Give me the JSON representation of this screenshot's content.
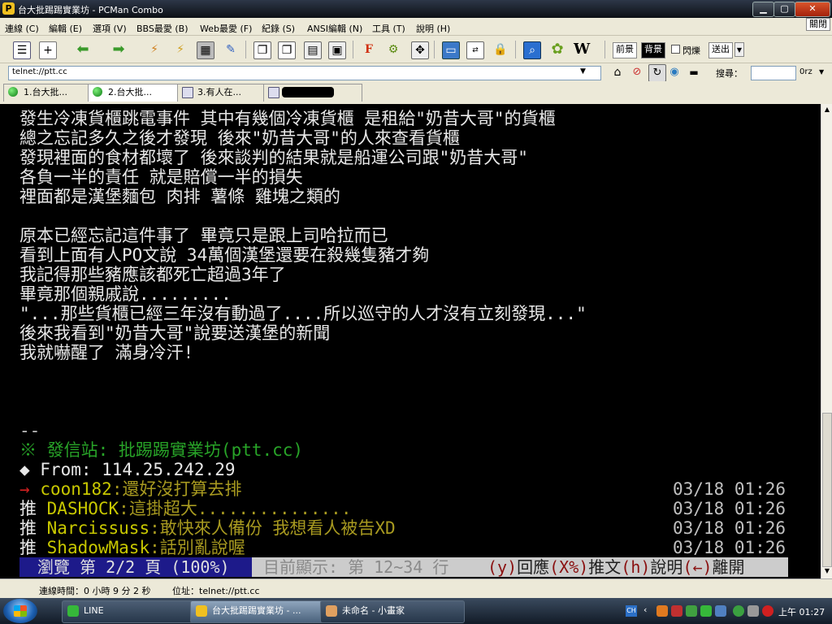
{
  "window": {
    "title": "台大批踢踢實業坊 - PCMan Combo",
    "app_icon": "PCMan",
    "controls": {
      "minimize": "▁",
      "maximize": "▢",
      "close": "✕"
    }
  },
  "menubar": {
    "items": [
      "連線 (C)",
      "編輯 (E)",
      "選項 (V)",
      "BBS最愛 (B)",
      "Web最愛 (F)",
      "紀錄 (S)",
      "ANSI編輯 (N)",
      "工具 (T)",
      "說明 (H)"
    ],
    "close_label": "關閉"
  },
  "toolbar": {
    "icons": [
      "connect-icon",
      "new-tab-icon",
      "back-icon",
      "forward-icon",
      "disconnect-icon",
      "reconnect-icon",
      "save-icon",
      "add-favorite-icon",
      "copy-icon",
      "paste-icon",
      "copy-ansi-icon",
      "screenshot-icon",
      "font-icon",
      "settings-icon",
      "fullscreen-icon",
      "monitor-icon",
      "auto-reply-icon",
      "lock-icon",
      "search-icon",
      "flower-icon",
      "wiki-icon"
    ],
    "foreground_label": "前景",
    "background_label": "背景",
    "blink_label": "閃爍",
    "send_label": "送出",
    "wiki_glyph": "W",
    "font_glyph": "F"
  },
  "addressbar": {
    "value": "telnet://ptt.cc",
    "search_label": "搜尋：",
    "search_value": "",
    "search_engine": "0rz"
  },
  "tabs": [
    {
      "label": "1.台大批..."
    },
    {
      "label": "2.台大批..."
    },
    {
      "label": "3.有人在..."
    },
    {
      "label": ""
    }
  ],
  "terminal": {
    "body_lines": [
      "發生冷凍貨櫃跳電事件 其中有幾個冷凍貨櫃 是租給\"奶昔大哥\"的貨櫃",
      "總之忘記多久之後才發現 後來\"奶昔大哥\"的人來查看貨櫃",
      "發現裡面的食材都壞了 後來談判的結果就是船運公司跟\"奶昔大哥\"",
      "各負一半的責任 就是賠償一半的損失",
      "裡面都是漢堡麵包 肉排 薯條 雞塊之類的",
      "",
      "原本已經忘記這件事了 畢竟只是跟上司哈拉而已",
      "看到上面有人PO文說 34萬個漢堡還要在殺幾隻豬才夠",
      "我記得那些豬應該都死亡超過3年了",
      "畢竟那個親戚說.........",
      "\"...那些貨櫃已經三年沒有動過了....所以巡守的人才沒有立刻發現...\"",
      "後來我看到\"奶昔大哥\"說要送漢堡的新聞",
      "我就嚇醒了 滿身冷汗!"
    ],
    "separator": "--",
    "origin": "※ 發信站: 批踢踢實業坊(ptt.cc)",
    "from": "◆ From: 114.25.242.29",
    "pushes": [
      {
        "tag": "→",
        "user": "coon182",
        "text": ":還好沒打算去排",
        "time": "03/18 01:26"
      },
      {
        "tag": "推",
        "user": "DASHOCK",
        "text": ":這掛超大...............",
        "time": "03/18 01:26"
      },
      {
        "tag": "推",
        "user": "Narcissuss",
        "text": ":敢快來人備份 我想看人被告XD",
        "time": "03/18 01:26"
      },
      {
        "tag": "推",
        "user": "ShadowMask",
        "text": ":話別亂說喔",
        "time": "03/18 01:26"
      }
    ],
    "statusline": {
      "browse": "瀏覽 第 2/2 頁 (100%)",
      "showing": "目前顯示: 第 12~34 行",
      "keys": [
        {
          "key": "(y)",
          "label": "回應"
        },
        {
          "key": "(X%)",
          "label": "推文"
        },
        {
          "key": "(h)",
          "label": "說明"
        },
        {
          "key": "(←)",
          "label": "離開"
        }
      ]
    }
  },
  "statusbar": {
    "connection_time": "連線時間：0 小時 9 分 2 秒",
    "address": "位址：telnet://ptt.cc"
  },
  "taskbar": {
    "tasks": [
      {
        "label": "LINE"
      },
      {
        "label": "台大批踢踢實業坊 - ..."
      },
      {
        "label": "未命名 - 小畫家"
      }
    ],
    "language": "CH",
    "clock": "上午 01:27"
  },
  "colors": {
    "terminal_bg": "#000000",
    "terminal_text": "#c0c0c0",
    "origin_green": "#28a428",
    "push_user_yellow": "#c8c800",
    "status_blue": "#1d1a8a"
  }
}
